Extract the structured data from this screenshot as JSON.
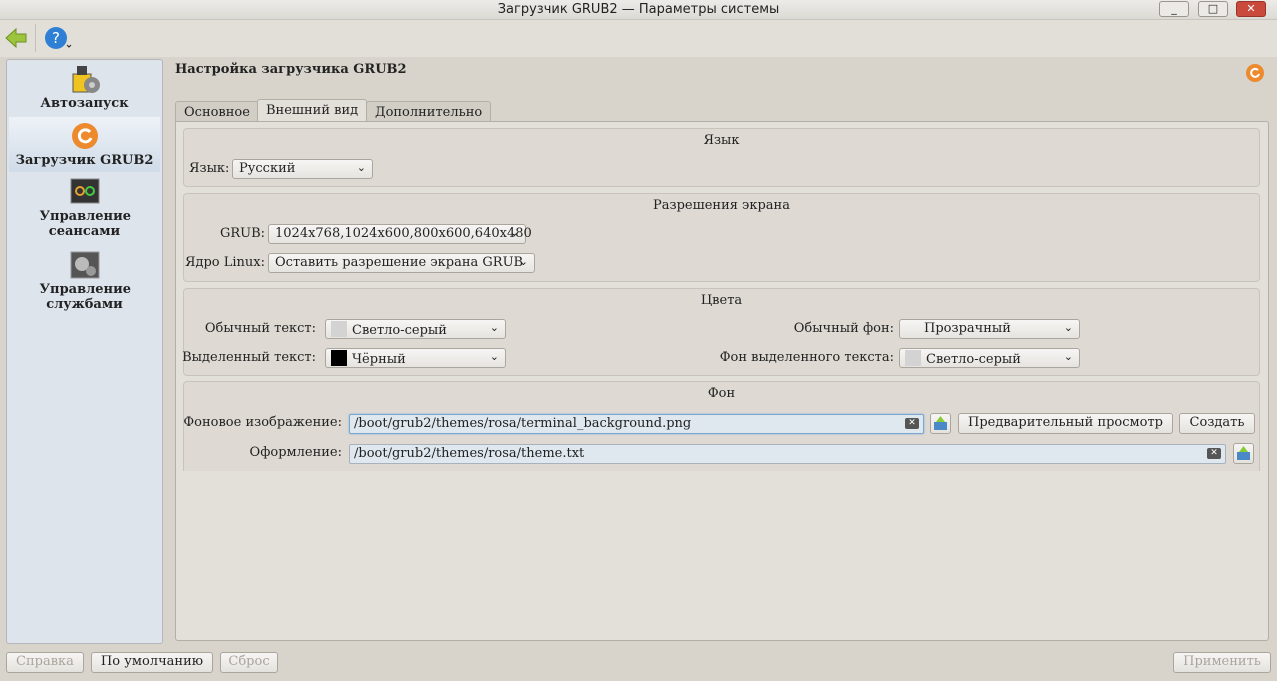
{
  "window": {
    "title": "Загрузчик GRUB2 — Параметры системы",
    "minimize": "_",
    "maximize": "□",
    "close": "✕"
  },
  "toolbar": {
    "back_icon": "arrow-left-icon",
    "help_icon": "help-icon"
  },
  "sidebar": {
    "items": [
      {
        "label": "Автозапуск",
        "icon": "autostart-icon"
      },
      {
        "label": "Загрузчик GRUB2",
        "icon": "grub-icon",
        "selected": true
      },
      {
        "label": "Управление сеансами",
        "icon": "session-icon"
      },
      {
        "label": "Управление службами",
        "icon": "services-icon"
      }
    ]
  },
  "main": {
    "title": "Настройка загрузчика GRUB2",
    "tabs": [
      {
        "label": "Основное"
      },
      {
        "label": "Внешний вид",
        "active": true
      },
      {
        "label": "Дополнительно"
      }
    ],
    "language": {
      "title": "Язык",
      "label": "Язык:",
      "value": "Русский"
    },
    "resolution": {
      "title": "Разрешения экрана",
      "grub_label": "GRUB:",
      "grub_value": "1024x768,1024x600,800x600,640x480",
      "linux_label": "Ядро Linux:",
      "linux_value": "Оставить разрешение экрана GRUB"
    },
    "colors": {
      "title": "Цвета",
      "normal_text_label": "Обычный текст:",
      "normal_text_value": "Светло-серый",
      "normal_text_color": "#d3d3d3",
      "hl_text_label": "Выделенный текст:",
      "hl_text_value": "Чёрный",
      "hl_text_color": "#000000",
      "normal_bg_label": "Обычный фон:",
      "normal_bg_value": "Прозрачный",
      "hl_bg_label": "Фон выделенного текста:",
      "hl_bg_value": "Светло-серый",
      "hl_bg_color": "#d3d3d3"
    },
    "background": {
      "title": "Фон",
      "image_label": "Фоновое изображение:",
      "image_value": "/boot/grub2/themes/rosa/terminal_background.png",
      "preview_label": "Предварительный просмотр",
      "create_label": "Создать",
      "theme_label": "Оформление:",
      "theme_value": "/boot/grub2/themes/rosa/theme.txt"
    }
  },
  "footer": {
    "help": "Справка",
    "defaults": "По умолчанию",
    "reset": "Сброс",
    "apply": "Применить"
  }
}
